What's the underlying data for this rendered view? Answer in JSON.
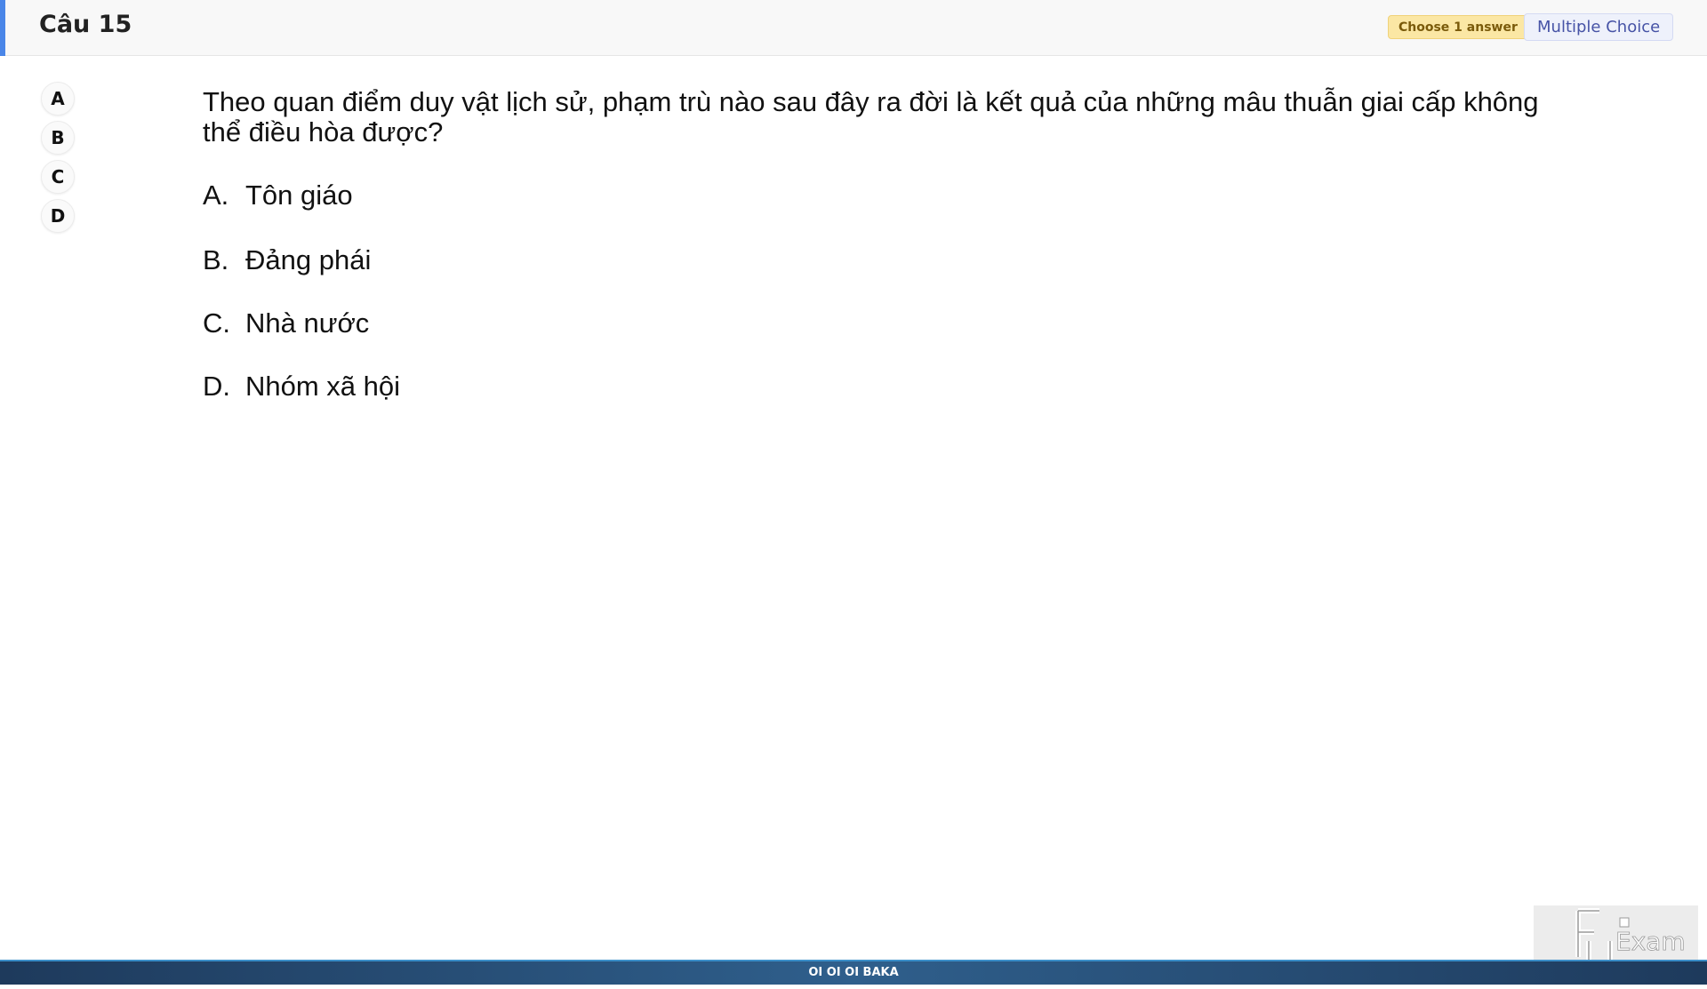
{
  "header": {
    "title": "Câu 15",
    "badge_choose": "Choose 1 answer",
    "badge_type": "Multiple Choice"
  },
  "answer_buttons": [
    "A",
    "B",
    "C",
    "D"
  ],
  "question": {
    "text": "Theo quan điểm duy vật lịch sử, phạm trù nào sau đây ra đời là kết quả của những mâu thuẫn giai cấp không thể điều hòa được?",
    "options": [
      {
        "letter": "A.",
        "text": "Tôn giáo"
      },
      {
        "letter": "B.",
        "text": "Đảng phái"
      },
      {
        "letter": "C.",
        "text": "Nhà nước"
      },
      {
        "letter": "D.",
        "text": "Nhóm xã hội"
      }
    ]
  },
  "footer": {
    "text": "OI OI OI BAKA"
  },
  "colors": {
    "accent": "#4a86e8",
    "badge_choose_bg": "#fbe7a4",
    "badge_type_bg": "#eef1fb"
  }
}
